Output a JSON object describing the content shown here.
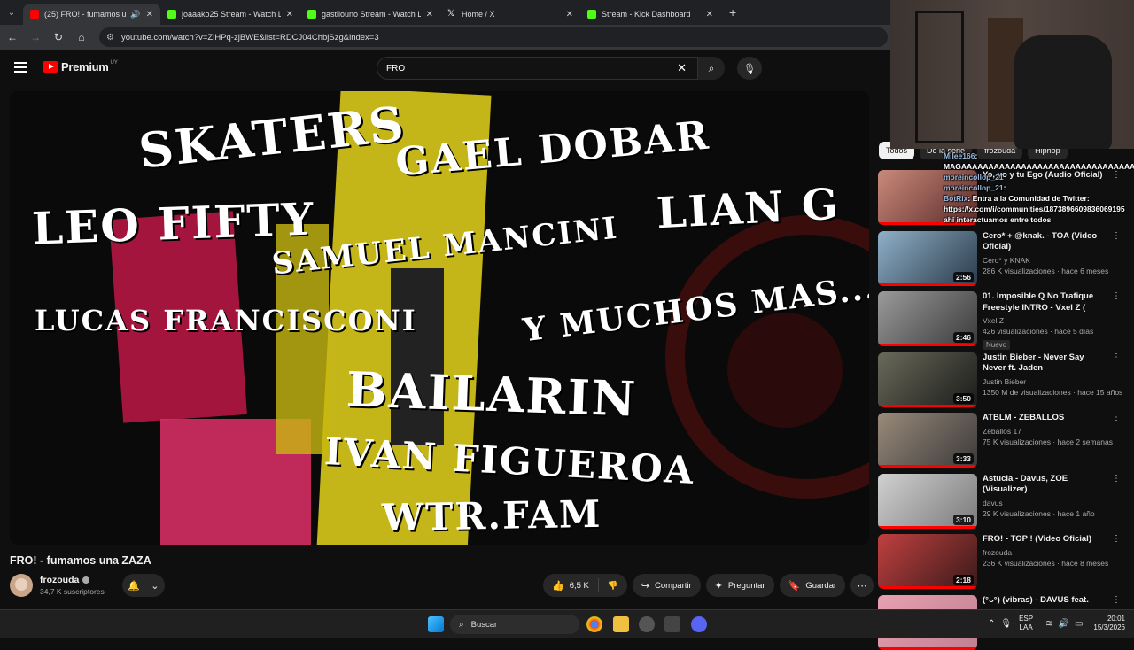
{
  "browser": {
    "tabs": [
      {
        "title": "(25) FRO! - fumamos una ZAZA",
        "color": "#ff0000"
      },
      {
        "title": "joaaako25 Stream - Watch Live",
        "color": "#53fc18"
      },
      {
        "title": "gastilouno Stream - Watch Live",
        "color": "#53fc18"
      },
      {
        "title": "Home / X",
        "color": "#ffffff"
      },
      {
        "title": "Stream - Kick Dashboard",
        "color": "#53fc18"
      }
    ],
    "url": "youtube.com/watch?v=ZiHPq-zjBWE&list=RDCJ04ChbjSzg&index=3"
  },
  "youtube": {
    "logo_text": "Premium",
    "country": "UY",
    "search_value": "FRO",
    "video_overlay": {
      "line1": "SKATERS",
      "line2": "GAEL DOBAR",
      "line3": "LEO FIFTY",
      "line4": "LIAN G",
      "line5": "SAMUEL MANCINI",
      "line6": "LUCAS FRANCISCONI",
      "line7": "Y MUCHOS MAS...",
      "line8": "BAILARIN",
      "line9": "IVAN FIGUEROA",
      "line10": "WTR.FAM"
    },
    "video_title": "FRO! - fumamos una ZAZA",
    "channel": {
      "name": "frozouda",
      "subs": "34,7 K suscriptores"
    },
    "actions": {
      "likes": "6,5 K",
      "share": "Compartir",
      "ask": "Preguntar",
      "save": "Guardar"
    },
    "chips": [
      "Todos",
      "De la serie",
      "frozouda",
      "Hiphop"
    ],
    "recommendations": [
      {
        "title": "Yo, yo y tu Ego (Audio Oficial)",
        "channel": "",
        "meta": "",
        "duration": "",
        "badge": "",
        "colors": [
          "#c98a7a",
          "#5a2a2a"
        ]
      },
      {
        "title": "Cero* + @knak. - TOA (Video Oficial)",
        "channel": "Cero* y KNAK",
        "meta": "286 K visualizaciones · hace 6 meses",
        "duration": "2:56",
        "badge": "",
        "colors": [
          "#8fb0c8",
          "#2a3a4a"
        ]
      },
      {
        "title": "01. Imposible Q No Trafique Freestyle INTRO - Vxel Z ( Pro...",
        "channel": "Vxel Z",
        "meta": "426 visualizaciones · hace 5 días",
        "duration": "2:46",
        "badge": "Nuevo",
        "colors": [
          "#9a9a9a",
          "#3a3a3a"
        ]
      },
      {
        "title": "Justin Bieber - Never Say Never ft. Jaden",
        "channel": "Justin Bieber",
        "meta": "1350 M de visualizaciones · hace 15 años",
        "duration": "3:50",
        "badge": "",
        "colors": [
          "#6a6a5a",
          "#1a1a1a"
        ]
      },
      {
        "title": "ATBLM - ZEBALLOS",
        "channel": "Zeballos 17",
        "meta": "75 K visualizaciones · hace 2 semanas",
        "duration": "3:33",
        "badge": "",
        "colors": [
          "#9a8a7a",
          "#3a3a3a"
        ]
      },
      {
        "title": "Astucia - Davus, ZOE (Visualizer)",
        "channel": "davus",
        "meta": "29 K visualizaciones · hace 1 año",
        "duration": "3:10",
        "badge": "",
        "colors": [
          "#d0d0d0",
          "#7a7a7a"
        ]
      },
      {
        "title": "FRO! - TOP ! (Video Oficial)",
        "channel": "frozouda",
        "meta": "236 K visualizaciones · hace 8 meses",
        "duration": "2:18",
        "badge": "",
        "colors": [
          "#c04040",
          "#3a1a1a"
        ]
      },
      {
        "title": "(°ᴗ°) (vibras) - DAVUS feat.",
        "channel": "",
        "meta": "",
        "duration": "",
        "badge": "",
        "colors": [
          "#e8a0b0",
          "#c08090"
        ]
      }
    ]
  },
  "chat": [
    {
      "user": "Milee166",
      "text": ": MAGAAAAAAAAAAAAAAAAAAAAAAAAAAAAAAAAAAA"
    },
    {
      "user": "moreincollop_21",
      "text": ""
    },
    {
      "user": "moreincollop_21",
      "text": ":"
    },
    {
      "user": "BotRix",
      "text": ": Entra a la Comunidad de Twitter: https://x.com/i/communities/1873896609836069195 ahi interactuamos entre todos"
    }
  ],
  "taskbar": {
    "search_label": "Buscar",
    "lang_top": "ESP",
    "lang_bottom": "LAA",
    "time": "20:01",
    "date": "15/3/2026"
  }
}
